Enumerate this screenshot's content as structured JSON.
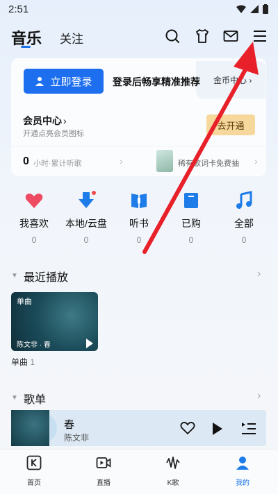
{
  "status_bar": {
    "time": "2:51"
  },
  "header": {
    "tabs": [
      {
        "label": "音乐"
      },
      {
        "label": "关注"
      }
    ],
    "icons": [
      "search-icon",
      "shirt-icon",
      "mail-icon",
      "menu-icon"
    ]
  },
  "member_card": {
    "login_button": "立即登录",
    "login_tip": "登录后畅享精准推荐",
    "coin_center": "金币中心 ›",
    "vip_title": "会员中心",
    "vip_chevron": "›",
    "vip_sub": "开通点亮会员图标",
    "open_button": "去开通",
    "listen_count": "0",
    "listen_label": "小时·累计听歌",
    "lyric_promo": "稀有歌词卡免费抽",
    "chevron": "›"
  },
  "quick": [
    {
      "label": "我喜欢",
      "count": "0"
    },
    {
      "label": "本地/云盘",
      "count": "0"
    },
    {
      "label": "听书",
      "count": "0"
    },
    {
      "label": "已购",
      "count": "0"
    },
    {
      "label": "全部",
      "count": "0"
    }
  ],
  "recent": {
    "title": "最近播放",
    "arrow": "›",
    "caret": "▼",
    "card_type": "单曲",
    "card_name": "陈文非 · 春",
    "caption": "单曲",
    "caption_count": "1"
  },
  "playlist": {
    "title": "歌单",
    "arrow": "›",
    "caret": "▼",
    "song_title": "春",
    "artist": "陈文非"
  },
  "bottom_nav": [
    {
      "label": "首页"
    },
    {
      "label": "直播"
    },
    {
      "label": "K歌"
    },
    {
      "label": "我的"
    }
  ],
  "colors": {
    "accent": "#1e6ff0",
    "vip_button": "#f6d79c",
    "annotation_arrow": "#e8202a"
  }
}
